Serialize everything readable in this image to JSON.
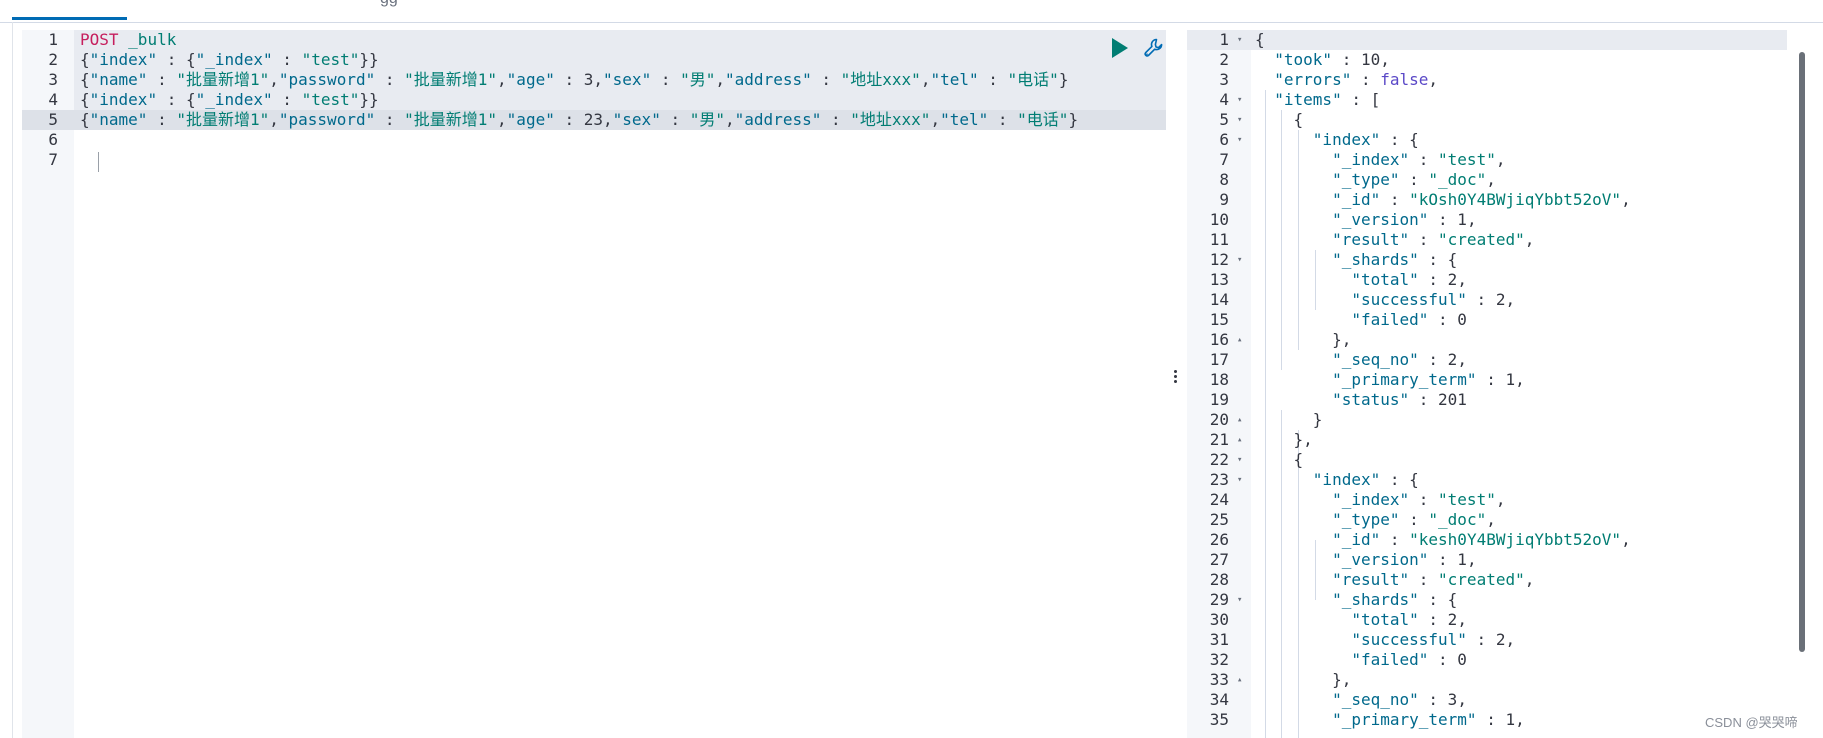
{
  "tabs": {
    "secondary_label": "gg"
  },
  "editor": {
    "request": {
      "method": "POST",
      "path": "_bulk"
    },
    "lines": [
      {
        "no": "1",
        "parts": [
          [
            "m",
            "POST"
          ],
          [
            "p",
            " "
          ],
          [
            "s",
            "_bulk"
          ]
        ]
      },
      {
        "no": "2",
        "parts": [
          [
            "p",
            "{"
          ],
          [
            "k",
            "\"index\""
          ],
          [
            "p",
            " : {"
          ],
          [
            "k",
            "\"_index\""
          ],
          [
            "p",
            " : "
          ],
          [
            "s",
            "\"test\""
          ],
          [
            "p",
            "}}"
          ]
        ]
      },
      {
        "no": "3",
        "parts": [
          [
            "p",
            "{"
          ],
          [
            "k",
            "\"name\""
          ],
          [
            "p",
            " : "
          ],
          [
            "s",
            "\"批量新增1\""
          ],
          [
            "p",
            ","
          ],
          [
            "k",
            "\"password\""
          ],
          [
            "p",
            " : "
          ],
          [
            "s",
            "\"批量新增1\""
          ],
          [
            "p",
            ","
          ],
          [
            "k",
            "\"age\""
          ],
          [
            "p",
            " : "
          ],
          [
            "n",
            "3"
          ],
          [
            "p",
            ","
          ],
          [
            "k",
            "\"sex\""
          ],
          [
            "p",
            " : "
          ],
          [
            "s",
            "\"男\""
          ],
          [
            "p",
            ","
          ],
          [
            "k",
            "\"address\""
          ],
          [
            "p",
            " : "
          ],
          [
            "s",
            "\"地址xxx\""
          ],
          [
            "p",
            ","
          ],
          [
            "k",
            "\"tel\""
          ],
          [
            "p",
            " : "
          ],
          [
            "s",
            "\"电话\""
          ],
          [
            "p",
            "}"
          ]
        ]
      },
      {
        "no": "4",
        "parts": [
          [
            "p",
            "{"
          ],
          [
            "k",
            "\"index\""
          ],
          [
            "p",
            " : {"
          ],
          [
            "k",
            "\"_index\""
          ],
          [
            "p",
            " : "
          ],
          [
            "s",
            "\"test\""
          ],
          [
            "p",
            "}}"
          ]
        ]
      },
      {
        "no": "5",
        "parts": [
          [
            "p",
            "{"
          ],
          [
            "k",
            "\"name\""
          ],
          [
            "p",
            " : "
          ],
          [
            "s",
            "\"批量新增1\""
          ],
          [
            "p",
            ","
          ],
          [
            "k",
            "\"password\""
          ],
          [
            "p",
            " : "
          ],
          [
            "s",
            "\"批量新增1\""
          ],
          [
            "p",
            ","
          ],
          [
            "k",
            "\"age\""
          ],
          [
            "p",
            " : "
          ],
          [
            "n",
            "23"
          ],
          [
            "p",
            ","
          ],
          [
            "k",
            "\"sex\""
          ],
          [
            "p",
            " : "
          ],
          [
            "s",
            "\"男\""
          ],
          [
            "p",
            ","
          ],
          [
            "k",
            "\"address\""
          ],
          [
            "p",
            " : "
          ],
          [
            "s",
            "\"地址xxx\""
          ],
          [
            "p",
            ","
          ],
          [
            "k",
            "\"tel\""
          ],
          [
            "p",
            " : "
          ],
          [
            "s",
            "\"电话\""
          ],
          [
            "p",
            "}"
          ]
        ]
      },
      {
        "no": "6",
        "parts": []
      },
      {
        "no": "7",
        "parts": []
      }
    ],
    "run_icon": "play-icon",
    "settings_icon": "wrench-icon"
  },
  "output": {
    "lines": [
      {
        "no": "1",
        "fold": "▾",
        "parts": [
          [
            "p",
            "{"
          ]
        ]
      },
      {
        "no": "2",
        "fold": "",
        "parts": [
          [
            "p",
            "  "
          ],
          [
            "k",
            "\"took\""
          ],
          [
            "p",
            " : "
          ],
          [
            "n",
            "10"
          ],
          [
            "p",
            ","
          ]
        ]
      },
      {
        "no": "3",
        "fold": "",
        "parts": [
          [
            "p",
            "  "
          ],
          [
            "k",
            "\"errors\""
          ],
          [
            "p",
            " : "
          ],
          [
            "b",
            "false"
          ],
          [
            "p",
            ","
          ]
        ]
      },
      {
        "no": "4",
        "fold": "▾",
        "parts": [
          [
            "p",
            "  "
          ],
          [
            "k",
            "\"items\""
          ],
          [
            "p",
            " : ["
          ]
        ]
      },
      {
        "no": "5",
        "fold": "▾",
        "parts": [
          [
            "p",
            "    {"
          ]
        ]
      },
      {
        "no": "6",
        "fold": "▾",
        "parts": [
          [
            "p",
            "      "
          ],
          [
            "k",
            "\"index\""
          ],
          [
            "p",
            " : {"
          ]
        ]
      },
      {
        "no": "7",
        "fold": "",
        "parts": [
          [
            "p",
            "        "
          ],
          [
            "k",
            "\"_index\""
          ],
          [
            "p",
            " : "
          ],
          [
            "s",
            "\"test\""
          ],
          [
            "p",
            ","
          ]
        ]
      },
      {
        "no": "8",
        "fold": "",
        "parts": [
          [
            "p",
            "        "
          ],
          [
            "k",
            "\"_type\""
          ],
          [
            "p",
            " : "
          ],
          [
            "s",
            "\"_doc\""
          ],
          [
            "p",
            ","
          ]
        ]
      },
      {
        "no": "9",
        "fold": "",
        "parts": [
          [
            "p",
            "        "
          ],
          [
            "k",
            "\"_id\""
          ],
          [
            "p",
            " : "
          ],
          [
            "s",
            "\"kOsh0Y4BWjiqYbbt52oV\""
          ],
          [
            "p",
            ","
          ]
        ]
      },
      {
        "no": "10",
        "fold": "",
        "parts": [
          [
            "p",
            "        "
          ],
          [
            "k",
            "\"_version\""
          ],
          [
            "p",
            " : "
          ],
          [
            "n",
            "1"
          ],
          [
            "p",
            ","
          ]
        ]
      },
      {
        "no": "11",
        "fold": "",
        "parts": [
          [
            "p",
            "        "
          ],
          [
            "k",
            "\"result\""
          ],
          [
            "p",
            " : "
          ],
          [
            "s",
            "\"created\""
          ],
          [
            "p",
            ","
          ]
        ]
      },
      {
        "no": "12",
        "fold": "▾",
        "parts": [
          [
            "p",
            "        "
          ],
          [
            "k",
            "\"_shards\""
          ],
          [
            "p",
            " : {"
          ]
        ]
      },
      {
        "no": "13",
        "fold": "",
        "parts": [
          [
            "p",
            "          "
          ],
          [
            "k",
            "\"total\""
          ],
          [
            "p",
            " : "
          ],
          [
            "n",
            "2"
          ],
          [
            "p",
            ","
          ]
        ]
      },
      {
        "no": "14",
        "fold": "",
        "parts": [
          [
            "p",
            "          "
          ],
          [
            "k",
            "\"successful\""
          ],
          [
            "p",
            " : "
          ],
          [
            "n",
            "2"
          ],
          [
            "p",
            ","
          ]
        ]
      },
      {
        "no": "15",
        "fold": "",
        "parts": [
          [
            "p",
            "          "
          ],
          [
            "k",
            "\"failed\""
          ],
          [
            "p",
            " : "
          ],
          [
            "n",
            "0"
          ]
        ]
      },
      {
        "no": "16",
        "fold": "▴",
        "parts": [
          [
            "p",
            "        },"
          ]
        ]
      },
      {
        "no": "17",
        "fold": "",
        "parts": [
          [
            "p",
            "        "
          ],
          [
            "k",
            "\"_seq_no\""
          ],
          [
            "p",
            " : "
          ],
          [
            "n",
            "2"
          ],
          [
            "p",
            ","
          ]
        ]
      },
      {
        "no": "18",
        "fold": "",
        "parts": [
          [
            "p",
            "        "
          ],
          [
            "k",
            "\"_primary_term\""
          ],
          [
            "p",
            " : "
          ],
          [
            "n",
            "1"
          ],
          [
            "p",
            ","
          ]
        ]
      },
      {
        "no": "19",
        "fold": "",
        "parts": [
          [
            "p",
            "        "
          ],
          [
            "k",
            "\"status\""
          ],
          [
            "p",
            " : "
          ],
          [
            "n",
            "201"
          ]
        ]
      },
      {
        "no": "20",
        "fold": "▴",
        "parts": [
          [
            "p",
            "      }"
          ]
        ]
      },
      {
        "no": "21",
        "fold": "▴",
        "parts": [
          [
            "p",
            "    },"
          ]
        ]
      },
      {
        "no": "22",
        "fold": "▾",
        "parts": [
          [
            "p",
            "    {"
          ]
        ]
      },
      {
        "no": "23",
        "fold": "▾",
        "parts": [
          [
            "p",
            "      "
          ],
          [
            "k",
            "\"index\""
          ],
          [
            "p",
            " : {"
          ]
        ]
      },
      {
        "no": "24",
        "fold": "",
        "parts": [
          [
            "p",
            "        "
          ],
          [
            "k",
            "\"_index\""
          ],
          [
            "p",
            " : "
          ],
          [
            "s",
            "\"test\""
          ],
          [
            "p",
            ","
          ]
        ]
      },
      {
        "no": "25",
        "fold": "",
        "parts": [
          [
            "p",
            "        "
          ],
          [
            "k",
            "\"_type\""
          ],
          [
            "p",
            " : "
          ],
          [
            "s",
            "\"_doc\""
          ],
          [
            "p",
            ","
          ]
        ]
      },
      {
        "no": "26",
        "fold": "",
        "parts": [
          [
            "p",
            "        "
          ],
          [
            "k",
            "\"_id\""
          ],
          [
            "p",
            " : "
          ],
          [
            "s",
            "\"kesh0Y4BWjiqYbbt52oV\""
          ],
          [
            "p",
            ","
          ]
        ]
      },
      {
        "no": "27",
        "fold": "",
        "parts": [
          [
            "p",
            "        "
          ],
          [
            "k",
            "\"_version\""
          ],
          [
            "p",
            " : "
          ],
          [
            "n",
            "1"
          ],
          [
            "p",
            ","
          ]
        ]
      },
      {
        "no": "28",
        "fold": "",
        "parts": [
          [
            "p",
            "        "
          ],
          [
            "k",
            "\"result\""
          ],
          [
            "p",
            " : "
          ],
          [
            "s",
            "\"created\""
          ],
          [
            "p",
            ","
          ]
        ]
      },
      {
        "no": "29",
        "fold": "▾",
        "parts": [
          [
            "p",
            "        "
          ],
          [
            "k",
            "\"_shards\""
          ],
          [
            "p",
            " : {"
          ]
        ]
      },
      {
        "no": "30",
        "fold": "",
        "parts": [
          [
            "p",
            "          "
          ],
          [
            "k",
            "\"total\""
          ],
          [
            "p",
            " : "
          ],
          [
            "n",
            "2"
          ],
          [
            "p",
            ","
          ]
        ]
      },
      {
        "no": "31",
        "fold": "",
        "parts": [
          [
            "p",
            "          "
          ],
          [
            "k",
            "\"successful\""
          ],
          [
            "p",
            " : "
          ],
          [
            "n",
            "2"
          ],
          [
            "p",
            ","
          ]
        ]
      },
      {
        "no": "32",
        "fold": "",
        "parts": [
          [
            "p",
            "          "
          ],
          [
            "k",
            "\"failed\""
          ],
          [
            "p",
            " : "
          ],
          [
            "n",
            "0"
          ]
        ]
      },
      {
        "no": "33",
        "fold": "▴",
        "parts": [
          [
            "p",
            "        },"
          ]
        ]
      },
      {
        "no": "34",
        "fold": "",
        "parts": [
          [
            "p",
            "        "
          ],
          [
            "k",
            "\"_seq_no\""
          ],
          [
            "p",
            " : "
          ],
          [
            "n",
            "3"
          ],
          [
            "p",
            ","
          ]
        ]
      },
      {
        "no": "35",
        "fold": "",
        "parts": [
          [
            "p",
            "        "
          ],
          [
            "k",
            "\"_primary_term\""
          ],
          [
            "p",
            " : "
          ],
          [
            "n",
            "1"
          ],
          [
            "p",
            ","
          ]
        ]
      }
    ]
  },
  "watermark": "CSDN @哭哭啼"
}
